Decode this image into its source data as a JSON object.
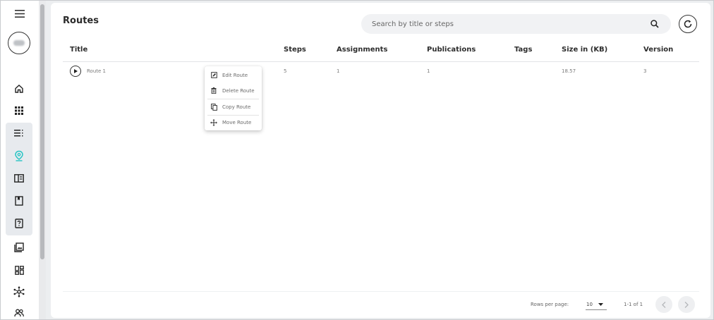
{
  "sidebar": {
    "menu_icon": "menu-icon",
    "items": [
      {
        "name": "home",
        "icon": "home-icon",
        "active": false
      },
      {
        "name": "apps",
        "icon": "grid-icon",
        "active": false
      },
      {
        "name": "list",
        "icon": "list-icon",
        "active": false
      },
      {
        "name": "routes",
        "icon": "location-pin-icon",
        "active": true
      },
      {
        "name": "split-view",
        "icon": "split-view-icon",
        "active": false
      },
      {
        "name": "bookmark",
        "icon": "bookmark-icon",
        "active": false
      },
      {
        "name": "help",
        "icon": "help-icon",
        "active": false
      },
      {
        "name": "gallery",
        "icon": "gallery-icon",
        "active": false
      },
      {
        "name": "dashboard",
        "icon": "dashboard-icon",
        "active": false
      },
      {
        "name": "network",
        "icon": "network-icon",
        "active": false
      },
      {
        "name": "users",
        "icon": "users-icon",
        "active": false
      }
    ],
    "accent_color": "#27c4c4"
  },
  "header": {
    "title": "Routes",
    "search_placeholder": "Search by title or steps"
  },
  "table": {
    "columns": [
      "Title",
      "Steps",
      "Assignments",
      "Publications",
      "Tags",
      "Size in (KB)",
      "Version"
    ],
    "rows": [
      {
        "title": "Route 1",
        "steps": "5",
        "assignments": "1",
        "publications": "1",
        "tags": "",
        "size": "18.57",
        "version": "3"
      }
    ]
  },
  "context_menu": {
    "items": [
      {
        "label": "Edit Route",
        "icon": "edit-icon"
      },
      {
        "label": "Delete Route",
        "icon": "trash-icon"
      },
      {
        "label": "Copy Route",
        "icon": "copy-icon"
      },
      {
        "label": "Move Route",
        "icon": "move-icon"
      }
    ]
  },
  "pagination": {
    "rows_per_page_label": "Rows per page:",
    "rows_per_page_value": "10",
    "range_text": "1-1 of 1"
  }
}
